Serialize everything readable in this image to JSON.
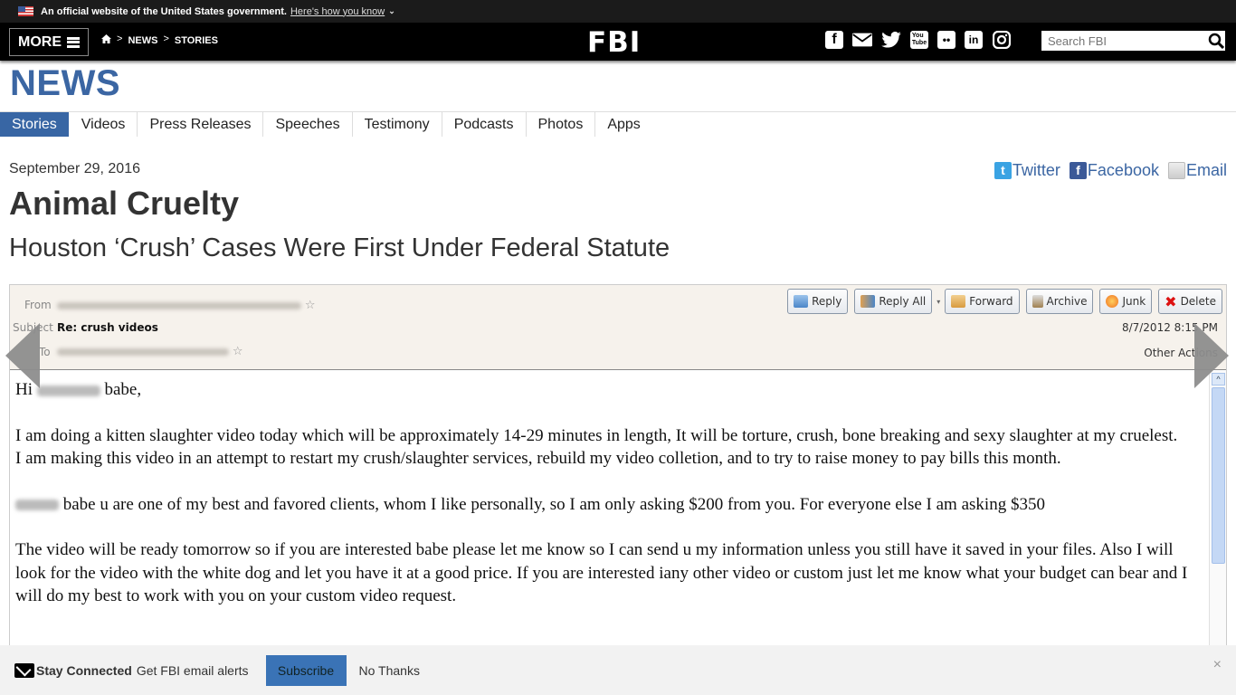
{
  "gov_banner": {
    "text": "An official website of the United States government.",
    "link": "Here's how you know",
    "chevron": "⌄"
  },
  "header": {
    "more_label": "MORE",
    "breadcrumb": [
      "NEWS",
      "STORIES"
    ],
    "breadcrumb_sep": ">",
    "logo": "FBI",
    "social_icons": [
      "facebook-icon",
      "email-icon",
      "twitter-icon",
      "youtube-icon",
      "flickr-icon",
      "linkedin-icon",
      "instagram-icon"
    ],
    "search_placeholder": "Search FBI"
  },
  "section": {
    "title": "NEWS",
    "tabs": [
      {
        "label": "Stories",
        "active": true
      },
      {
        "label": "Videos"
      },
      {
        "label": "Press Releases"
      },
      {
        "label": "Speeches"
      },
      {
        "label": "Testimony"
      },
      {
        "label": "Podcasts"
      },
      {
        "label": "Photos"
      },
      {
        "label": "Apps"
      }
    ]
  },
  "article": {
    "date": "September 29, 2016",
    "title": "Animal Cruelty",
    "subtitle": "Houston ‘Crush’ Cases Were First Under Federal Statute",
    "share": {
      "twitter": "Twitter",
      "facebook": "Facebook",
      "email": "Email"
    }
  },
  "email_image": {
    "from_label": "From",
    "subject_label": "Subject",
    "subject": "Re: crush videos",
    "to_label": "To",
    "buttons": [
      "Reply",
      "Reply All",
      "Forward",
      "Archive",
      "Junk",
      "Delete"
    ],
    "timestamp": "8/7/2012 8:15 PM",
    "other_actions": "Other Actions",
    "body": {
      "greeting_pre": "Hi",
      "greeting_post": "babe,",
      "p1_line1": "I am doing a kitten slaughter video today which will be approximately 14-29 minutes in length, It will be torture, crush, bone breaking and  sexy slaughter at my cruelest.",
      "p1_line2": "I am making this video in an attempt to restart my crush/slaughter services, rebuild my video colletion, and to try to raise money to pay bills this month.",
      "p2": "babe u are one of my best and favored clients, whom I like personally, so I am only asking $200 from you. For everyone else I am asking $350",
      "p3": "The video will be ready tomorrow so if you are interested babe please let me know so I can send u my information unless you still have it saved in your files. Also I will look for the video with the white dog and let you have it at a good price. If you are interested iany other video or custom just let me know what your  budget can bear and I will do my best to work with you on your custom video request."
    }
  },
  "alert_bar": {
    "bold": "Stay Connected",
    "text": "Get FBI email alerts",
    "subscribe": "Subscribe",
    "no_thanks": "No Thanks",
    "close": "×"
  }
}
